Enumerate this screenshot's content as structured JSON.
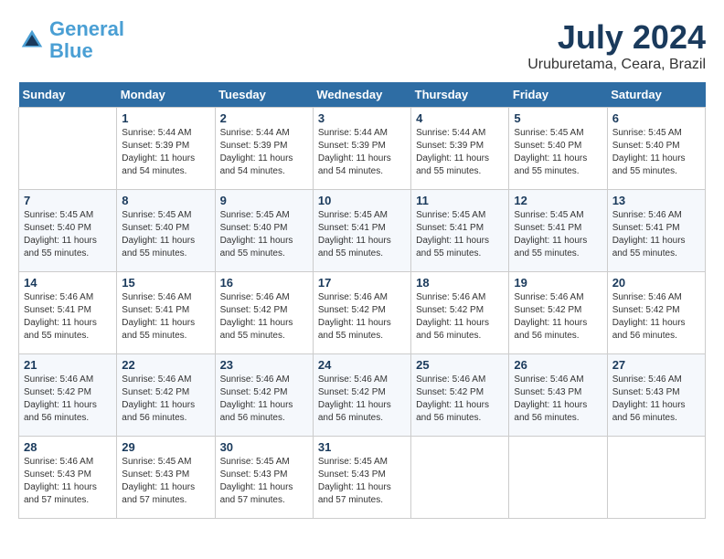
{
  "header": {
    "logo_line1": "General",
    "logo_line2": "Blue",
    "month": "July 2024",
    "location": "Uruburetama, Ceara, Brazil"
  },
  "weekdays": [
    "Sunday",
    "Monday",
    "Tuesday",
    "Wednesday",
    "Thursday",
    "Friday",
    "Saturday"
  ],
  "weeks": [
    [
      {
        "day": "",
        "info": ""
      },
      {
        "day": "1",
        "info": "Sunrise: 5:44 AM\nSunset: 5:39 PM\nDaylight: 11 hours\nand 54 minutes."
      },
      {
        "day": "2",
        "info": "Sunrise: 5:44 AM\nSunset: 5:39 PM\nDaylight: 11 hours\nand 54 minutes."
      },
      {
        "day": "3",
        "info": "Sunrise: 5:44 AM\nSunset: 5:39 PM\nDaylight: 11 hours\nand 54 minutes."
      },
      {
        "day": "4",
        "info": "Sunrise: 5:44 AM\nSunset: 5:39 PM\nDaylight: 11 hours\nand 55 minutes."
      },
      {
        "day": "5",
        "info": "Sunrise: 5:45 AM\nSunset: 5:40 PM\nDaylight: 11 hours\nand 55 minutes."
      },
      {
        "day": "6",
        "info": "Sunrise: 5:45 AM\nSunset: 5:40 PM\nDaylight: 11 hours\nand 55 minutes."
      }
    ],
    [
      {
        "day": "7",
        "info": "Sunrise: 5:45 AM\nSunset: 5:40 PM\nDaylight: 11 hours\nand 55 minutes."
      },
      {
        "day": "8",
        "info": "Sunrise: 5:45 AM\nSunset: 5:40 PM\nDaylight: 11 hours\nand 55 minutes."
      },
      {
        "day": "9",
        "info": "Sunrise: 5:45 AM\nSunset: 5:40 PM\nDaylight: 11 hours\nand 55 minutes."
      },
      {
        "day": "10",
        "info": "Sunrise: 5:45 AM\nSunset: 5:41 PM\nDaylight: 11 hours\nand 55 minutes."
      },
      {
        "day": "11",
        "info": "Sunrise: 5:45 AM\nSunset: 5:41 PM\nDaylight: 11 hours\nand 55 minutes."
      },
      {
        "day": "12",
        "info": "Sunrise: 5:45 AM\nSunset: 5:41 PM\nDaylight: 11 hours\nand 55 minutes."
      },
      {
        "day": "13",
        "info": "Sunrise: 5:46 AM\nSunset: 5:41 PM\nDaylight: 11 hours\nand 55 minutes."
      }
    ],
    [
      {
        "day": "14",
        "info": "Sunrise: 5:46 AM\nSunset: 5:41 PM\nDaylight: 11 hours\nand 55 minutes."
      },
      {
        "day": "15",
        "info": "Sunrise: 5:46 AM\nSunset: 5:41 PM\nDaylight: 11 hours\nand 55 minutes."
      },
      {
        "day": "16",
        "info": "Sunrise: 5:46 AM\nSunset: 5:42 PM\nDaylight: 11 hours\nand 55 minutes."
      },
      {
        "day": "17",
        "info": "Sunrise: 5:46 AM\nSunset: 5:42 PM\nDaylight: 11 hours\nand 55 minutes."
      },
      {
        "day": "18",
        "info": "Sunrise: 5:46 AM\nSunset: 5:42 PM\nDaylight: 11 hours\nand 56 minutes."
      },
      {
        "day": "19",
        "info": "Sunrise: 5:46 AM\nSunset: 5:42 PM\nDaylight: 11 hours\nand 56 minutes."
      },
      {
        "day": "20",
        "info": "Sunrise: 5:46 AM\nSunset: 5:42 PM\nDaylight: 11 hours\nand 56 minutes."
      }
    ],
    [
      {
        "day": "21",
        "info": "Sunrise: 5:46 AM\nSunset: 5:42 PM\nDaylight: 11 hours\nand 56 minutes."
      },
      {
        "day": "22",
        "info": "Sunrise: 5:46 AM\nSunset: 5:42 PM\nDaylight: 11 hours\nand 56 minutes."
      },
      {
        "day": "23",
        "info": "Sunrise: 5:46 AM\nSunset: 5:42 PM\nDaylight: 11 hours\nand 56 minutes."
      },
      {
        "day": "24",
        "info": "Sunrise: 5:46 AM\nSunset: 5:42 PM\nDaylight: 11 hours\nand 56 minutes."
      },
      {
        "day": "25",
        "info": "Sunrise: 5:46 AM\nSunset: 5:42 PM\nDaylight: 11 hours\nand 56 minutes."
      },
      {
        "day": "26",
        "info": "Sunrise: 5:46 AM\nSunset: 5:43 PM\nDaylight: 11 hours\nand 56 minutes."
      },
      {
        "day": "27",
        "info": "Sunrise: 5:46 AM\nSunset: 5:43 PM\nDaylight: 11 hours\nand 56 minutes."
      }
    ],
    [
      {
        "day": "28",
        "info": "Sunrise: 5:46 AM\nSunset: 5:43 PM\nDaylight: 11 hours\nand 57 minutes."
      },
      {
        "day": "29",
        "info": "Sunrise: 5:45 AM\nSunset: 5:43 PM\nDaylight: 11 hours\nand 57 minutes."
      },
      {
        "day": "30",
        "info": "Sunrise: 5:45 AM\nSunset: 5:43 PM\nDaylight: 11 hours\nand 57 minutes."
      },
      {
        "day": "31",
        "info": "Sunrise: 5:45 AM\nSunset: 5:43 PM\nDaylight: 11 hours\nand 57 minutes."
      },
      {
        "day": "",
        "info": ""
      },
      {
        "day": "",
        "info": ""
      },
      {
        "day": "",
        "info": ""
      }
    ]
  ]
}
